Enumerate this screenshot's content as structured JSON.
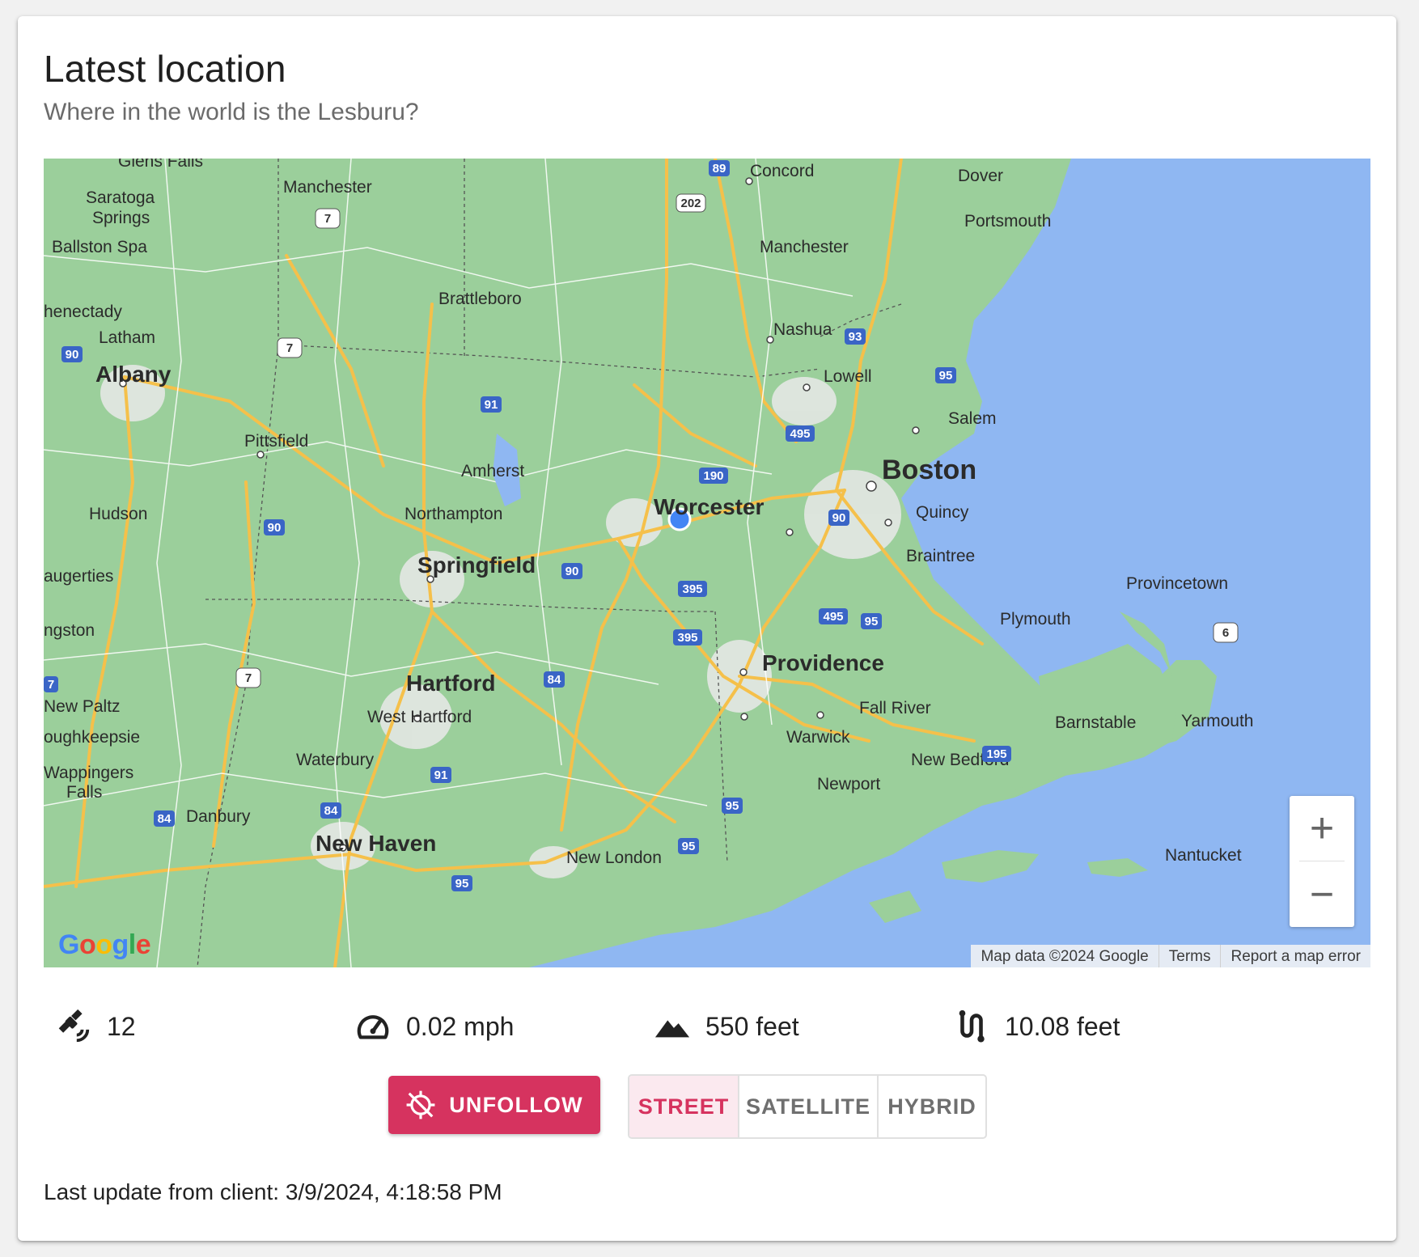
{
  "header": {
    "title": "Latest location",
    "subtitle": "Where in the world is the Lesburu?"
  },
  "map": {
    "labels": {
      "glens_falls": "Glens Falls",
      "saratoga": "Saratoga",
      "springs": "Springs",
      "ballston_spa": "Ballston Spa",
      "schenectady": "henectady",
      "latham": "Latham",
      "albany": "Albany",
      "hudson": "Hudson",
      "saugerties": "augerties",
      "kingston": "ngston",
      "new_paltz": "New Paltz",
      "poughkeepsie": "oughkeepsie",
      "wappingers": "Wappingers",
      "falls": "Falls",
      "danbury": "Danbury",
      "manchester_vt": "Manchester",
      "brattleboro": "Brattleboro",
      "pittsfield": "Pittsfield",
      "amherst": "Amherst",
      "northampton": "Northampton",
      "springfield": "Springfield",
      "hartford": "Hartford",
      "west_hartford": "West Hartford",
      "waterbury": "Waterbury",
      "new_haven": "New Haven",
      "new_london": "New London",
      "worcester": "Worcester",
      "concord": "Concord",
      "dover": "Dover",
      "portsmouth": "Portsmouth",
      "manchester_nh": "Manchester",
      "nashua": "Nashua",
      "lowell": "Lowell",
      "salem": "Salem",
      "boston": "Boston",
      "quincy": "Quincy",
      "braintree": "Braintree",
      "providence": "Providence",
      "warwick": "Warwick",
      "fall_river": "Fall River",
      "new_bedford": "New Bedford",
      "newport": "Newport",
      "plymouth": "Plymouth",
      "provincetown": "Provincetown",
      "barnstable": "Barnstable",
      "yarmouth": "Yarmouth",
      "nantucket": "Nantucket"
    },
    "shields": [
      "89",
      "202",
      "7",
      "7",
      "93",
      "95",
      "91",
      "495",
      "190",
      "90",
      "90",
      "90",
      "90",
      "395",
      "395",
      "495",
      "95",
      "84",
      "84",
      "84",
      "91",
      "95",
      "95",
      "195",
      "6",
      "7",
      "7",
      "95"
    ],
    "google_logo": "Google",
    "attribution": {
      "map_data": "Map data ©2024 Google",
      "terms": "Terms",
      "report": "Report a map error"
    },
    "zoom_in": "+",
    "zoom_out": "−"
  },
  "stats": {
    "satellites": "12",
    "speed": "0.02 mph",
    "altitude": "550 feet",
    "accuracy": "10.08 feet"
  },
  "actions": {
    "unfollow_label": "UNFOLLOW",
    "map_types": [
      "STREET",
      "SATELLITE",
      "HYBRID"
    ],
    "active_map_type": "STREET"
  },
  "footer": {
    "last_update": "Last update from client: 3/9/2024, 4:18:58 PM"
  },
  "colors": {
    "accent": "#d6335f",
    "land": "#9bcf9b",
    "water": "#8fb7f2",
    "road": "#f5c04a",
    "marker": "#4285f4"
  }
}
